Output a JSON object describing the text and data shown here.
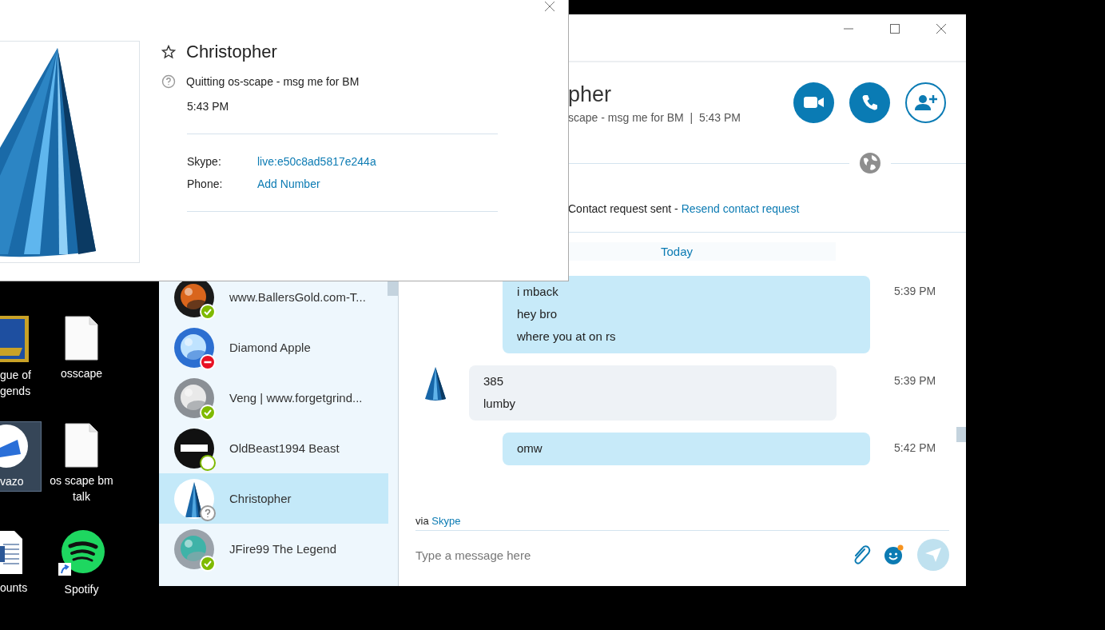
{
  "desktop_icons": [
    {
      "lines": [
        "gue of",
        "gends"
      ],
      "kind": "game",
      "selected": false
    },
    {
      "lines": [
        "osscape"
      ],
      "kind": "text-file",
      "selected": false
    },
    {
      "lines": [
        "vazo"
      ],
      "kind": "app",
      "selected": true
    },
    {
      "lines": [
        "os scape bm",
        "talk"
      ],
      "kind": "text-file",
      "selected": false
    },
    {
      "lines": [
        "ounts"
      ],
      "kind": "word-file",
      "selected": false
    },
    {
      "lines": [
        "Spotify"
      ],
      "kind": "spotify",
      "selected": false
    }
  ],
  "skype_window": {
    "contacts": [
      {
        "name": "www.BallersGold.com-T...",
        "kind": "online",
        "selected": false
      },
      {
        "name": "Diamond Apple",
        "kind": "busy",
        "selected": false
      },
      {
        "name": "Veng | www.forgetgrind...",
        "kind": "online",
        "selected": false
      },
      {
        "name": "OldBeast1994 Beast",
        "kind": "idle",
        "selected": false
      },
      {
        "name": "Christopher",
        "kind": "unknown",
        "selected": true
      },
      {
        "name": "JFire99 The Legend",
        "kind": "online",
        "selected": false
      }
    ],
    "header": {
      "name": "pher",
      "mood_line": "scape - msg me for BM  |  5:43 PM"
    },
    "notice": {
      "text": "Contact request sent -",
      "link": "Resend contact request"
    },
    "day_label": "Today",
    "messages": [
      {
        "kind": "outgoing",
        "lines": [
          "i mback",
          "hey bro",
          "where you at on rs"
        ],
        "time": "5:39 PM"
      },
      {
        "kind": "incoming",
        "lines": [
          "385",
          "lumby"
        ],
        "time": "5:39 PM"
      },
      {
        "kind": "outgoing",
        "lines": [
          "omw"
        ],
        "time": "5:42 PM"
      }
    ],
    "via": {
      "prefix": "via",
      "link": "Skype"
    },
    "composer": {
      "placeholder": "Type a message here"
    }
  },
  "profile_popup": {
    "favorite": false,
    "name": "Christopher",
    "mood": "Quitting os-scape - msg me for BM",
    "time": "5:43 PM",
    "fields": [
      {
        "label": "Skype:",
        "value": "live:e50c8ad5817e244a"
      },
      {
        "label": "Phone:",
        "value": "Add Number"
      }
    ]
  }
}
